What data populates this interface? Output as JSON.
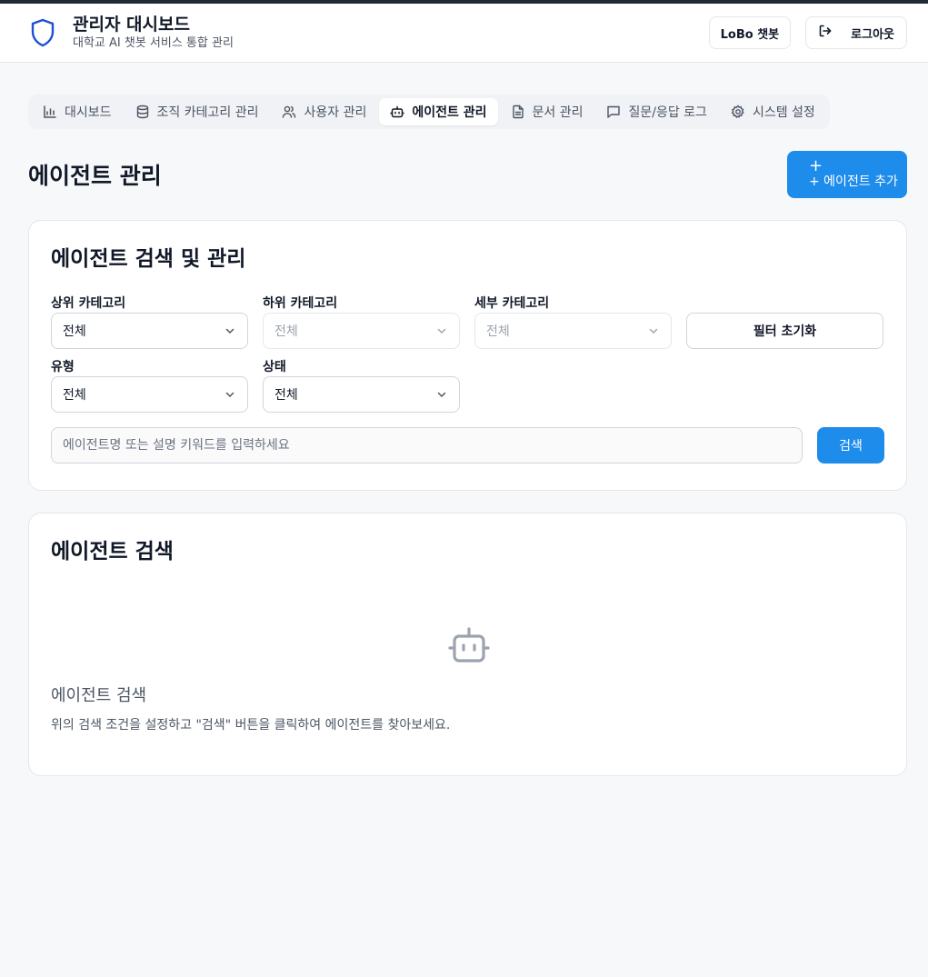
{
  "header": {
    "title": "관리자 대시보드",
    "subtitle": "대학교 AI 챗봇 서비스 통합 관리",
    "chatbot_button": "LoBo 챗봇",
    "logout_button": "로그아웃"
  },
  "tabs": [
    {
      "label": "대시보드",
      "icon": "chart-icon"
    },
    {
      "label": "조직 카테고리 관리",
      "icon": "database-icon"
    },
    {
      "label": "사용자 관리",
      "icon": "users-icon"
    },
    {
      "label": "에이전트 관리",
      "icon": "bot-icon",
      "active": true
    },
    {
      "label": "문서 관리",
      "icon": "file-icon"
    },
    {
      "label": "질문/응답 로그",
      "icon": "message-icon"
    },
    {
      "label": "시스템 설정",
      "icon": "gear-icon"
    }
  ],
  "page": {
    "title": "에이전트 관리",
    "add_button": "+ 에이전트 추가"
  },
  "filters": {
    "title": "에이전트 검색 및 관리",
    "top_category": {
      "label": "상위 카테고리",
      "value": "전체"
    },
    "sub_category": {
      "label": "하위 카테고리",
      "value": "전체"
    },
    "detail_category": {
      "label": "세부 카테고리",
      "value": "전체"
    },
    "reset_button": "필터 초기화",
    "type": {
      "label": "유형",
      "value": "전체"
    },
    "status": {
      "label": "상태",
      "value": "전체"
    },
    "search_placeholder": "에이전트명 또는 설명 키워드를 입력하세요",
    "search_button": "검색"
  },
  "results": {
    "title": "에이전트 검색",
    "empty_title": "에이전트 검색",
    "empty_desc": "위의 검색 조건을 설정하고 \"검색\" 버튼을 클릭하여 에이전트를 찾아보세요."
  },
  "colors": {
    "accent": "#1d8ceb",
    "shield": "#1d4ed8"
  }
}
